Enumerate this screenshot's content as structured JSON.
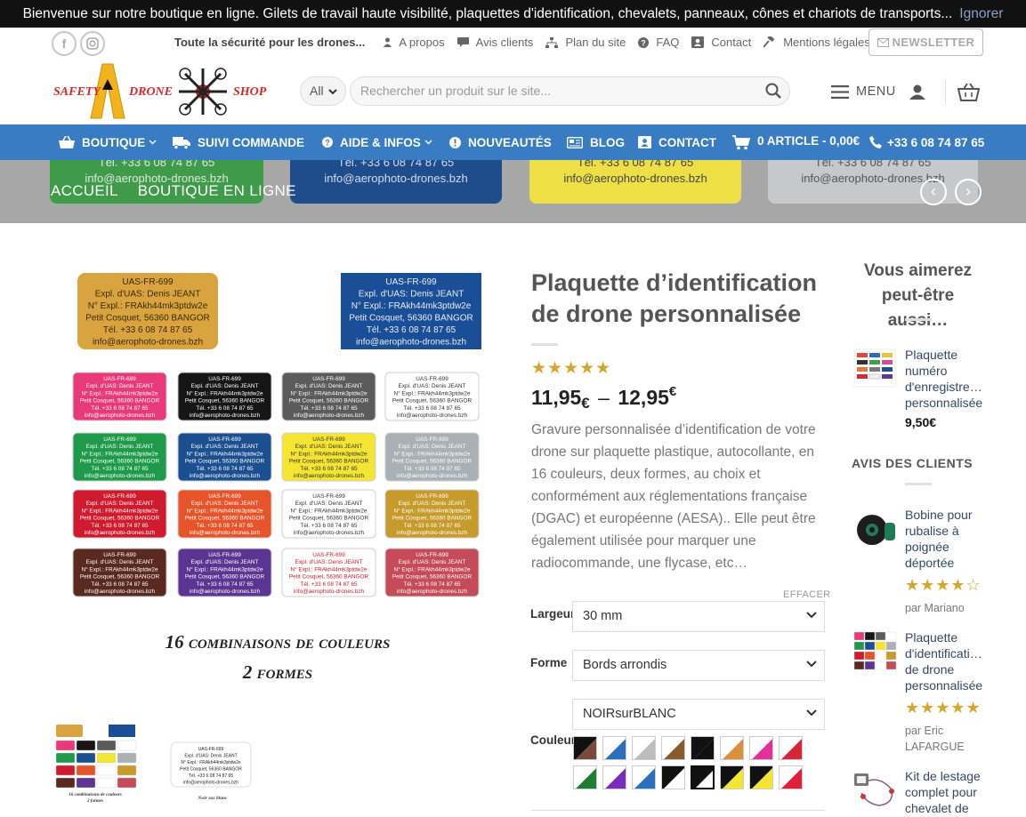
{
  "notice": {
    "text": "Bienvenue sur notre boutique en ligne. Gilets de travail haute visibilité, plaquettes d'identification, chevalets, panneaux, cônes et chariots de transports...",
    "dismiss": "Ignorer"
  },
  "topbar": {
    "tagline": "Toute la sécurité pour les drones...",
    "links": [
      "A propos",
      "Avis clients",
      "Plan du site",
      "FAQ",
      "Contact",
      "Mentions légales"
    ],
    "newsletter": "NEWSLETTER"
  },
  "logo": {
    "word1": "SAFETY",
    "word2": "DRONE",
    "word3": "SHOP"
  },
  "header": {
    "category": "All",
    "search_placeholder": "Rechercher un produit sur le site...",
    "menu": "MENU"
  },
  "mainnav": {
    "boutique": "BOUTIQUE",
    "suivi": "SUIVI COMMANDE",
    "aide": "AIDE & INFOS",
    "nouveautes": "NOUVEAUTÉS",
    "blog": "BLOG",
    "contact": "CONTACT",
    "cart": "0 ARTICLE - 0,00€",
    "phone": "+33 6 08 74 87 65"
  },
  "banner": {
    "plate_phone": "Tél. +33 6 08 74 87 65",
    "plate_email": "info@aerophoto-drones.bzh",
    "crumbs": [
      "ACCUEIL",
      "BOUTIQUE EN LIGNE"
    ]
  },
  "product_image": {
    "plate_lines": [
      "UAS-FR-699",
      "Expl. d'UAS: Denis JEANT",
      "N° Expl.: FRAkh44mk3ptdw2e",
      "Petit Cosquet, 56360 BANGOR",
      "Tél. +33 6 08 74 87 65",
      "info@aerophoto-drones.bzh"
    ],
    "caption1": "16 combinaisons de couleurs",
    "caption2": "2 formes",
    "thumb2_caption": "Noir sur blanc",
    "grid_colors": [
      [
        "#e8397b",
        "#161616",
        "#5b5b5b",
        "#ffffff"
      ],
      [
        "#1f9a4b",
        "#1c4f8f",
        "#f4e532",
        "#a9b1b6"
      ],
      [
        "#d01a2e",
        "#e8542a",
        "#ffffff",
        "#c79a2c"
      ],
      [
        "#5a2a20",
        "#5c3593",
        "#ffffff",
        "#c44b57"
      ]
    ],
    "grid_text_colors": [
      [
        "#fff",
        "#fff",
        "#fff",
        "#333"
      ],
      [
        "#fff",
        "#fff",
        "#333",
        "#fff"
      ],
      [
        "#fff",
        "#fff",
        "#333",
        "#fff"
      ],
      [
        "#fff",
        "#fff",
        "#d01a2e",
        "#fff"
      ]
    ]
  },
  "product": {
    "title": "Plaquette d’identification de drone personnalisée",
    "rating_stars": "★★★★★",
    "price_min": "11,95",
    "price_max": "12,95",
    "currency": "€",
    "price_sep": "–",
    "description": "Gravure personnalisée d’identification de votre drone sur plaquette plastique, autocollante, en 16 couleurs, deux formes, au choix et conformément aux réglementations française (DGAC) et européenne (AESA).. Elle peut être également utilisée pour marquer une radiocommande, une flycase, etc…",
    "reset": "EFFACER",
    "largeur_label": "Largeur",
    "largeur_value": "30 mm",
    "forme_label": "Forme",
    "forme_value": "Bords arrondis",
    "couleur_label": "Couleur",
    "couleur_value": "NOIRsurBLANC"
  },
  "swatches": [
    [
      "#7a4a3a",
      "#2d6fbf",
      "#bdbdbd",
      "#8b5a2b",
      "#111111",
      "#d9903a",
      "#e0329a",
      "#d72638"
    ],
    [
      "#1e7d32",
      "#7b2cbf",
      "#2d6fbf",
      "#ffffff",
      "#ffffff",
      "#f4e532",
      "#f4e532",
      "#e0203a"
    ]
  ],
  "sidebar": {
    "title": "Vous aimerez peut-être aussi…",
    "p1_name": "Plaquette numéro d'enregistre… personnalisée",
    "p1_price": "9,50€",
    "reviews_title": "AVIS DES CLIENTS",
    "r1_name": "Bobine pour rubalise à poignée déportée",
    "r1_stars": "★★★★☆",
    "r1_by": "par Mariano",
    "r2_name": "Plaquette d'identificati… de drone personnalisée",
    "r2_stars": "★★★★★",
    "r2_by": "par Eric LAFARGUE",
    "r3_name": "Kit de lestage complet pour chevalet de"
  }
}
